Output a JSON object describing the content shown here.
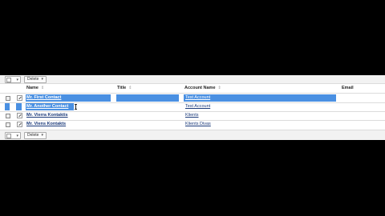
{
  "toolbar": {
    "delete_label": "Delete"
  },
  "columns": {
    "name": "Name",
    "title": "Title",
    "account_name": "Account Name",
    "email": "Email"
  },
  "rows": [
    {
      "name": "Mr. First Contact",
      "title": "",
      "account": "Test Account",
      "selected": true
    },
    {
      "name": "Mr. Another Contact",
      "title": "",
      "account": "Test Account",
      "selected": true
    },
    {
      "name": "Mr. Vierra Kontaktis",
      "title": "",
      "account": "Klients",
      "selected": false
    },
    {
      "name": "Mr. Viens Kontakts",
      "title": "",
      "account": "Klients Divas",
      "selected": false
    }
  ],
  "colors": {
    "selection": "#4a90e2",
    "link": "#1b3a7a"
  }
}
